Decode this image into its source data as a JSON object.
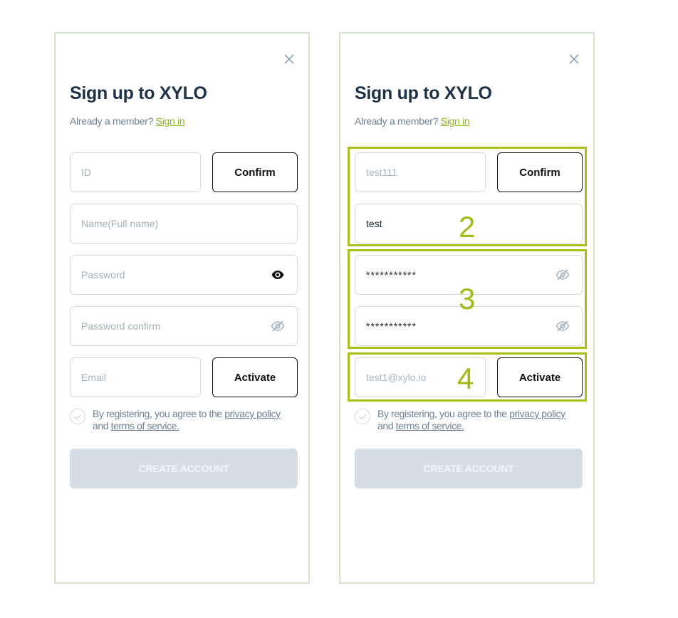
{
  "accent_color": "#8bb51e",
  "annotation_color": "#a3c31c",
  "left_panel": {
    "title": "Sign up to XYLO",
    "member_text": "Already a member?",
    "sign_in_link": "Sign in",
    "id_placeholder": "ID",
    "confirm_label": "Confirm",
    "name_placeholder": "Name(Full name)",
    "password_placeholder": "Password",
    "password_confirm_placeholder": "Password confirm",
    "email_placeholder": "Email",
    "activate_label": "Activate",
    "agree_prefix": "By registering, you agree to the",
    "privacy_link": "privacy policy",
    "agree_and": "and",
    "terms_link": "terms of service.",
    "create_label": "CREATE ACCOUNT"
  },
  "right_panel": {
    "title": "Sign up to XYLO",
    "member_text": "Already a member?",
    "sign_in_link": "Sign in",
    "id_value": "test111",
    "confirm_label": "Confirm",
    "name_value": "test",
    "password_value": "***********",
    "password_confirm_value": "***********",
    "email_value": "test1@xylo.io",
    "activate_label": "Activate",
    "agree_prefix": "By registering, you agree to the",
    "privacy_link": "privacy policy",
    "agree_and": "and",
    "terms_link": "terms of service.",
    "create_label": "CREATE ACCOUNT"
  },
  "annotations": [
    "2",
    "3",
    "4"
  ],
  "icons": {
    "close": "close-icon",
    "eye_open": "eye-icon",
    "eye_closed": "eye-off-icon",
    "check": "check-circle-icon"
  }
}
